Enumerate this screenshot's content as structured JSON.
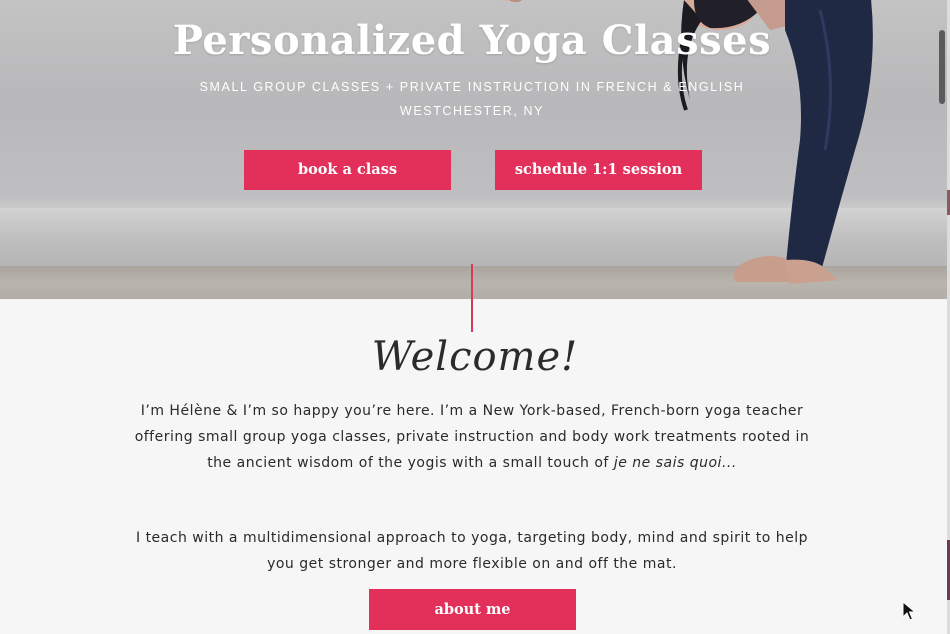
{
  "hero": {
    "title": "Personalized Yoga Classes",
    "subtitle_line1": "SMALL GROUP CLASSES + PRIVATE INSTRUCTION IN FRENCH & ENGLISH",
    "subtitle_line2": "WESTCHESTER, NY",
    "book_label": "book a class",
    "schedule_label": "schedule 1:1 session"
  },
  "welcome": {
    "heading": "Welcome!",
    "paragraph1_main": "I’m Hélène & I’m so happy you’re here. I’m a New York-based, French-born yoga teacher offering small group yoga classes, private instruction and body work treatments rooted in the ancient wisdom of the yogis with a small touch of ",
    "paragraph1_italic": "je ne sais quoi",
    "paragraph1_end": "...",
    "paragraph2": "I teach with a multidimensional approach to yoga, targeting body, mind and spirit to help you get stronger and more flexible on and off the mat.",
    "about_label": "about me"
  },
  "colors": {
    "accent": "#e3305b",
    "text": "#2a2a2a",
    "background": "#f7f6f6"
  },
  "icons": {
    "cursor": "pointer-cursor-icon"
  }
}
